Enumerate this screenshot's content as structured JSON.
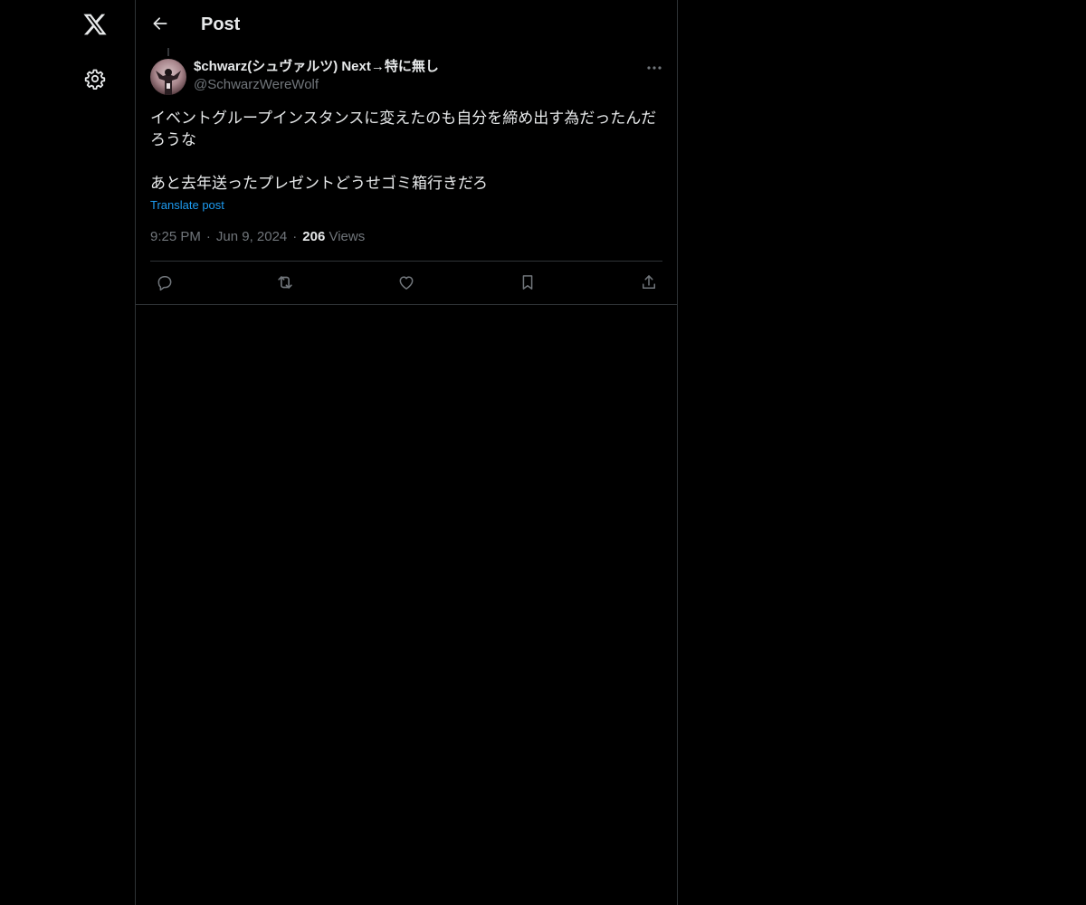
{
  "header": {
    "title": "Post",
    "back_icon": "arrow-left-icon"
  },
  "nav": {
    "logo_icon": "x-logo-icon",
    "settings_icon": "gear-icon"
  },
  "post": {
    "author": {
      "display_name": "$chwarz(シュヴァルツ) Next→特に無し",
      "handle": "@SchwarzWereWolf"
    },
    "text_lines": [
      "イベントグループインスタンスに変えたのも自分を締め出す為だったんだろうな",
      "あと去年送ったプレゼントどうせゴミ箱行きだろ"
    ],
    "translate_label": "Translate post",
    "time": "9:25 PM",
    "date": "Jun 9, 2024",
    "views_count": "206",
    "views_label": "Views",
    "separator": "·",
    "actions": [
      {
        "name": "reply",
        "icon": "reply-icon"
      },
      {
        "name": "repost",
        "icon": "repost-icon"
      },
      {
        "name": "like",
        "icon": "heart-icon"
      },
      {
        "name": "bookmark",
        "icon": "bookmark-icon"
      },
      {
        "name": "share",
        "icon": "share-icon"
      }
    ]
  },
  "colors": {
    "background": "#000000",
    "text": "#e7e9ea",
    "muted": "#71767b",
    "link": "#1d9bf0",
    "border": "#2f3336"
  }
}
